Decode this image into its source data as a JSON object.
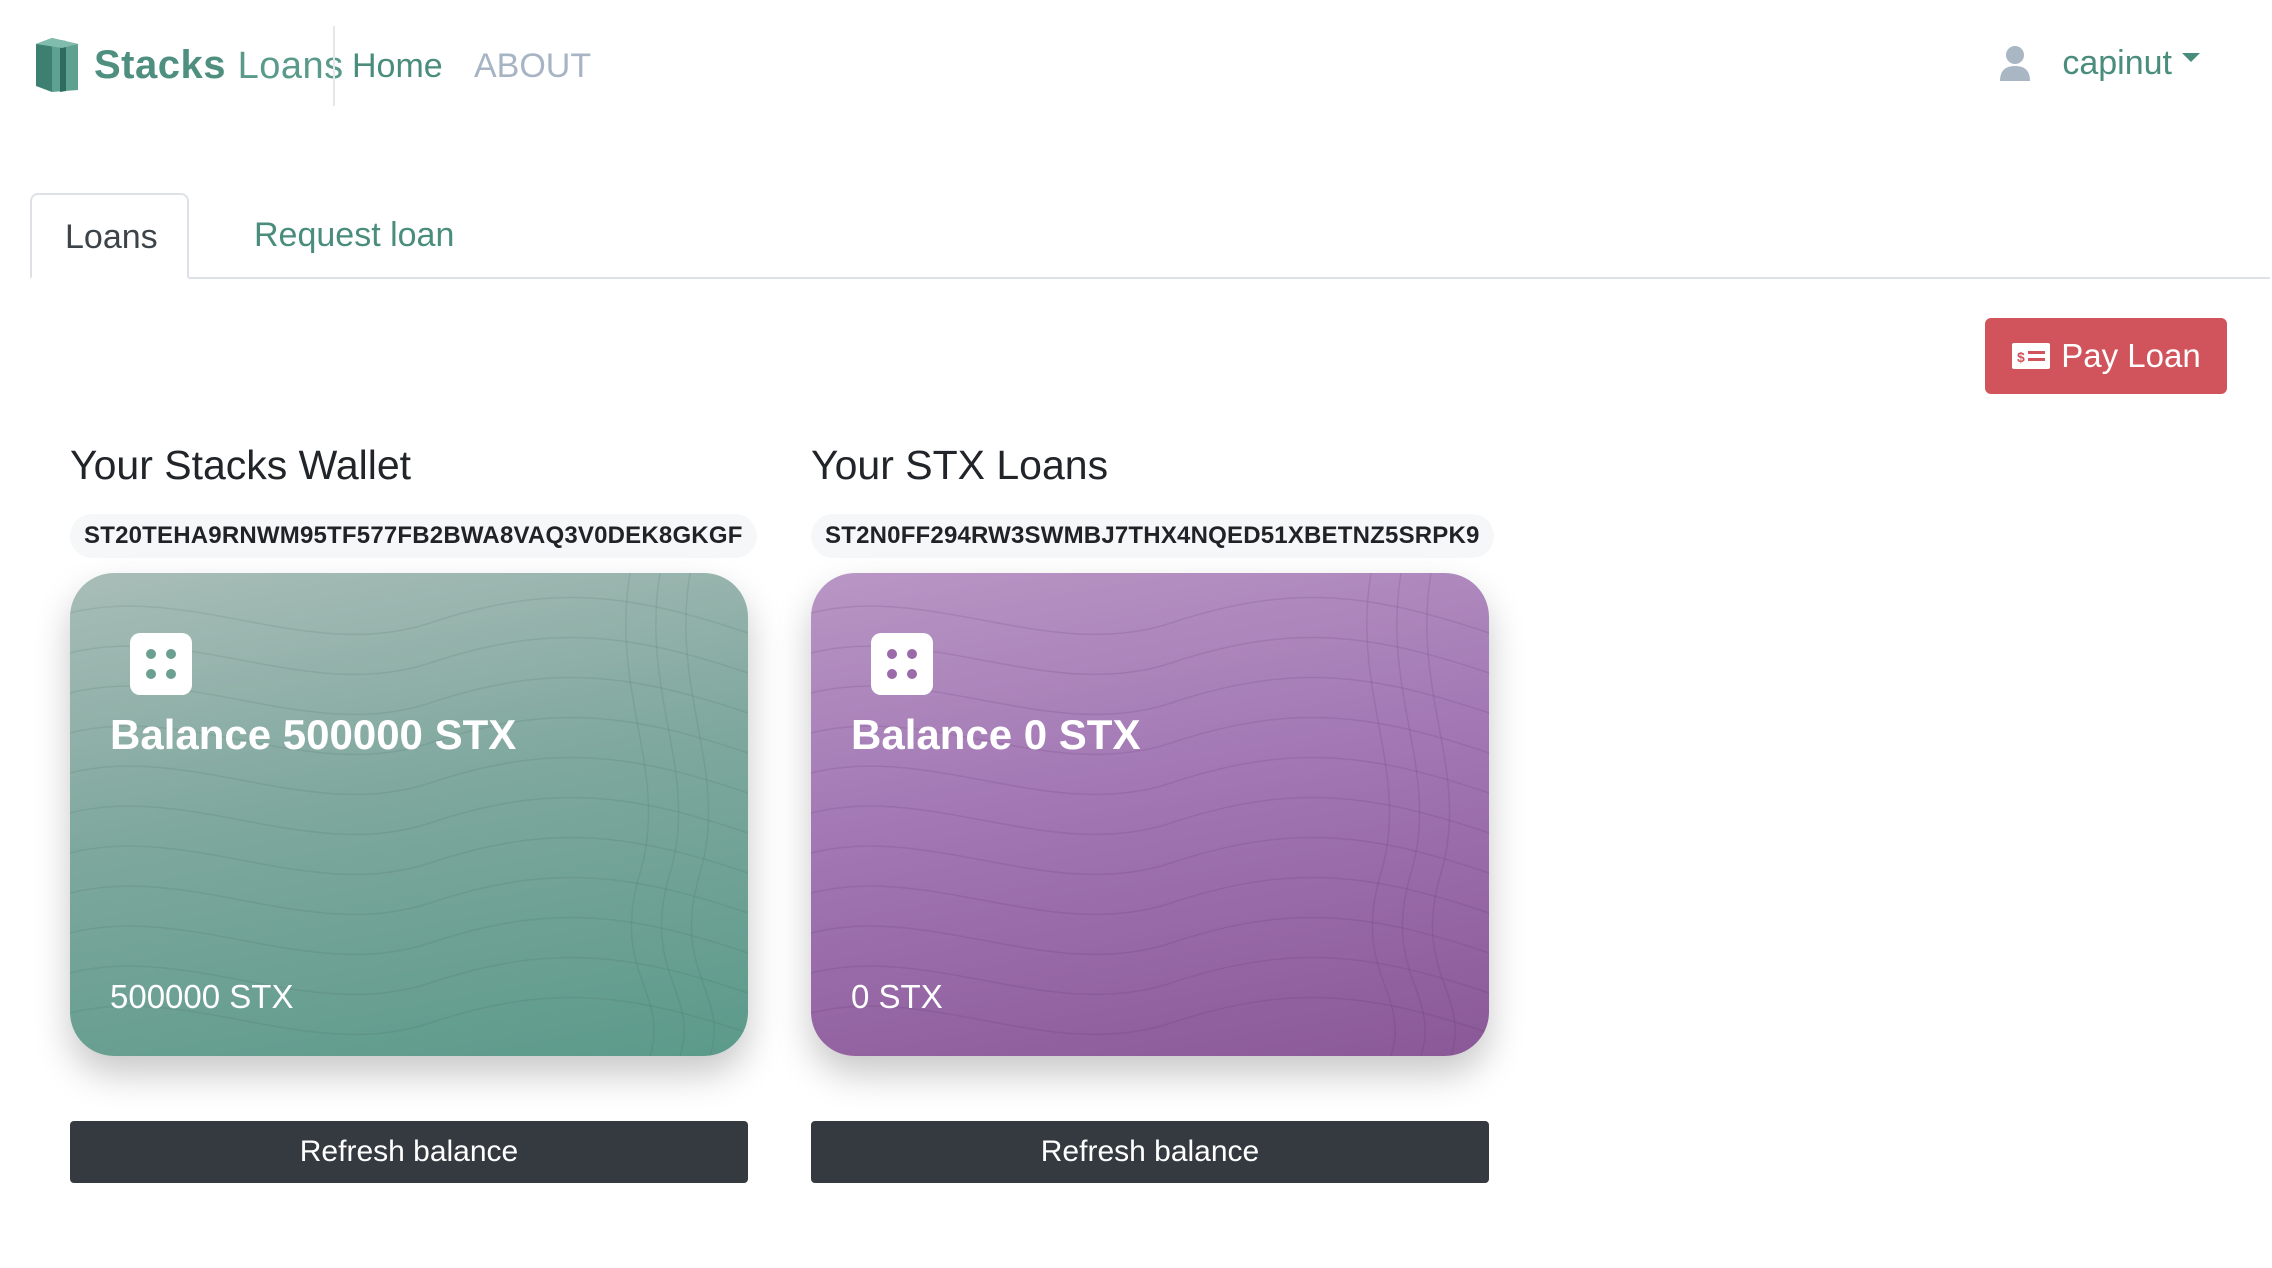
{
  "brand": {
    "name_bold": "Stacks",
    "name_light": "Loans"
  },
  "nav": {
    "home": "Home",
    "about": "ABOUT"
  },
  "user": {
    "name": "capinut"
  },
  "tabs": [
    {
      "label": "Loans",
      "active": true
    },
    {
      "label": "Request loan",
      "active": false
    }
  ],
  "actions": {
    "pay_loan": "Pay Loan"
  },
  "wallet": {
    "title": "Your Stacks Wallet",
    "address": "ST20TEHA9RNWM95TF577FB2BWA8VAQ3V0DEK8GKGF",
    "balance_label": "Balance 500000 STX",
    "amount": "500000 STX",
    "refresh": "Refresh balance"
  },
  "loans": {
    "title": "Your STX Loans",
    "address": "ST2N0FF294RW3SWMBJ7THX4NQED51XBETNZ5SRPK9",
    "balance_label": "Balance 0 STX",
    "amount": "0 STX",
    "refresh": "Refresh balance"
  },
  "colors": {
    "brand": "#4a8d7d",
    "pay_button": "#d1545c",
    "refresh_button": "#343a40",
    "wallet_card": "#5b9a8a",
    "loans_card": "#8a5896"
  },
  "icons": {
    "logo": "stacks-logo-icon",
    "user": "user-icon",
    "pay": "money-bill-icon",
    "chip": "card-chip-icon"
  }
}
